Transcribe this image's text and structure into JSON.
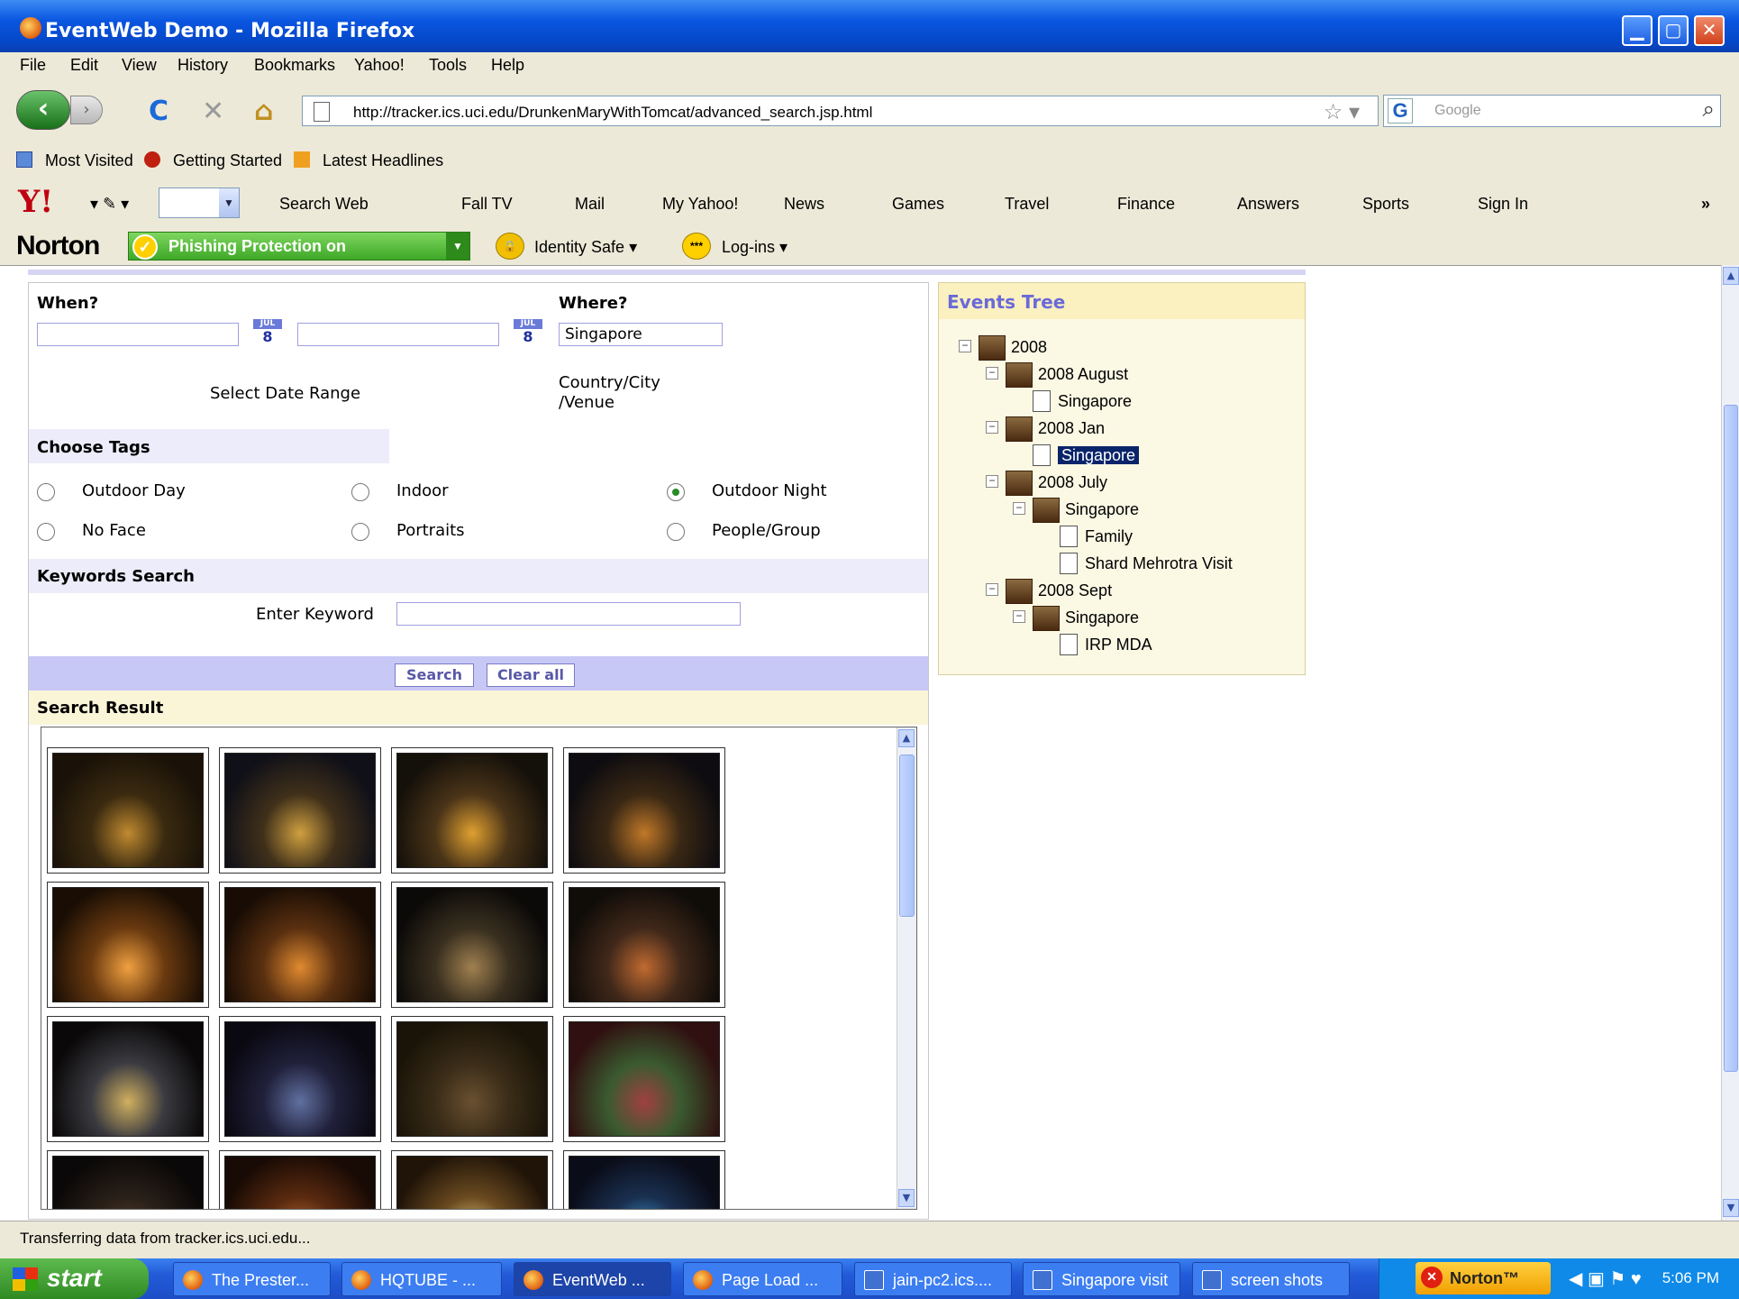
{
  "window": {
    "title": "EventWeb Demo - Mozilla Firefox",
    "minimize": "▁",
    "maximize": "▢",
    "close": "✕"
  },
  "menu": [
    "File",
    "Edit",
    "View",
    "History",
    "Bookmarks",
    "Yahoo!",
    "Tools",
    "Help"
  ],
  "nav": {
    "url": "http://tracker.ics.uci.edu/DrunkenMaryWithTomcat/advanced_search.jsp.html",
    "search_placeholder": "Google",
    "back_icon": "back-arrow-icon",
    "reload_icon": "reload-icon",
    "stop_icon": "stop-icon",
    "home_icon": "home-icon"
  },
  "bookmarks": [
    "Most Visited",
    "Getting Started",
    "Latest Headlines"
  ],
  "yahoo_toolbar": {
    "logo": "Y!",
    "search": "Search Web",
    "items": [
      "Fall TV",
      "Mail",
      "My Yahoo!",
      "News",
      "Games",
      "Travel",
      "Finance",
      "Answers",
      "Sports",
      "Sign In"
    ],
    "more": "»"
  },
  "norton_toolbar": {
    "logo": "Norton",
    "phishing": "Phishing Protection on",
    "identity": "Identity Safe ▾",
    "logins": "Log-ins ▾",
    "logins_icon_text": "***"
  },
  "form": {
    "when_label": "When?",
    "where_label": "Where?",
    "date_from": "",
    "date_to": "",
    "cal_month": "JUL",
    "cal_day": "8",
    "date_range_label": "Select Date Range",
    "where_value": "Singapore",
    "where_hint_line1": "Country/City",
    "where_hint_line2": "/Venue",
    "tags_label": "Choose Tags",
    "tags": [
      {
        "label": "Outdoor Day",
        "selected": false
      },
      {
        "label": "Indoor",
        "selected": false
      },
      {
        "label": "Outdoor Night",
        "selected": true
      },
      {
        "label": "No Face",
        "selected": false
      },
      {
        "label": "Portraits",
        "selected": false
      },
      {
        "label": "People/Group",
        "selected": false
      }
    ],
    "keywords_label": "Keywords Search",
    "keyword_prompt": "Enter Keyword",
    "keyword_value": "",
    "search_button": "Search",
    "clear_button": "Clear all",
    "result_label": "Search Result"
  },
  "results": {
    "thumbnails": [
      {
        "colors": [
          "#1a1208",
          "#3a2a10",
          "#c08a30"
        ]
      },
      {
        "colors": [
          "#101018",
          "#40301a",
          "#d0a040"
        ]
      },
      {
        "colors": [
          "#14100a",
          "#4a3418",
          "#e0a030"
        ]
      },
      {
        "colors": [
          "#0e0c10",
          "#3a2814",
          "#c07828"
        ]
      },
      {
        "colors": [
          "#1a0e04",
          "#6a3a10",
          "#f0a040"
        ]
      },
      {
        "colors": [
          "#180c04",
          "#5a3010",
          "#e08a30"
        ]
      },
      {
        "colors": [
          "#0c0a08",
          "#3a3020",
          "#a08050"
        ]
      },
      {
        "colors": [
          "#100c08",
          "#40281a",
          "#c06a30"
        ]
      },
      {
        "colors": [
          "#0a0808",
          "#3a3a40",
          "#d0b060"
        ]
      },
      {
        "colors": [
          "#0a0810",
          "#20203a",
          "#6070a0"
        ]
      },
      {
        "colors": [
          "#1a1408",
          "#3a2c18",
          "#6a5030"
        ]
      },
      {
        "colors": [
          "#301010",
          "#3a5a30",
          "#a04040"
        ]
      },
      {
        "colors": [
          "#0a0808",
          "#2a2018",
          "#5a4030"
        ]
      },
      {
        "colors": [
          "#180a04",
          "#5a2a10",
          "#c07030"
        ]
      },
      {
        "colors": [
          "#201408",
          "#6a4a20",
          "#f0d080"
        ]
      },
      {
        "colors": [
          "#0a0c18",
          "#1a3050",
          "#40a0e0"
        ]
      }
    ]
  },
  "tree": {
    "title": "Events Tree",
    "nodes": [
      {
        "label": "2008",
        "kind": "folder",
        "toggle": "−",
        "selected": false
      },
      {
        "label": "2008 August",
        "kind": "folder",
        "toggle": "−",
        "selected": false
      },
      {
        "label": "Singapore",
        "kind": "doc",
        "toggle": "",
        "selected": false
      },
      {
        "label": "2008 Jan",
        "kind": "folder",
        "toggle": "−",
        "selected": false
      },
      {
        "label": "Singapore",
        "kind": "doc",
        "toggle": "",
        "selected": true
      },
      {
        "label": "2008 July",
        "kind": "folder",
        "toggle": "−",
        "selected": false
      },
      {
        "label": "Singapore",
        "kind": "folder",
        "toggle": "−",
        "selected": false
      },
      {
        "label": "Family",
        "kind": "doc",
        "toggle": "",
        "selected": false
      },
      {
        "label": "Shard Mehrotra Visit",
        "kind": "doc",
        "toggle": "",
        "selected": false
      },
      {
        "label": "2008 Sept",
        "kind": "folder",
        "toggle": "−",
        "selected": false
      },
      {
        "label": "Singapore",
        "kind": "folder",
        "toggle": "−",
        "selected": false
      },
      {
        "label": "IRP MDA",
        "kind": "doc",
        "toggle": "",
        "selected": false
      }
    ]
  },
  "status": "Transferring data from tracker.ics.uci.edu...",
  "taskbar": {
    "start": "start",
    "buttons": [
      {
        "label": "The Prester...",
        "icon": "firefox",
        "active": false
      },
      {
        "label": "HQTUBE - ...",
        "icon": "firefox",
        "active": false
      },
      {
        "label": "EventWeb ...",
        "icon": "firefox",
        "active": true
      },
      {
        "label": "Page Load ...",
        "icon": "firefox",
        "active": false
      },
      {
        "label": "jain-pc2.ics....",
        "icon": "doc",
        "active": false
      },
      {
        "label": "Singapore visit",
        "icon": "doc",
        "active": false
      },
      {
        "label": "screen shots",
        "icon": "doc",
        "active": false
      }
    ],
    "norton": "Norton™",
    "clock": "5:06 PM"
  }
}
